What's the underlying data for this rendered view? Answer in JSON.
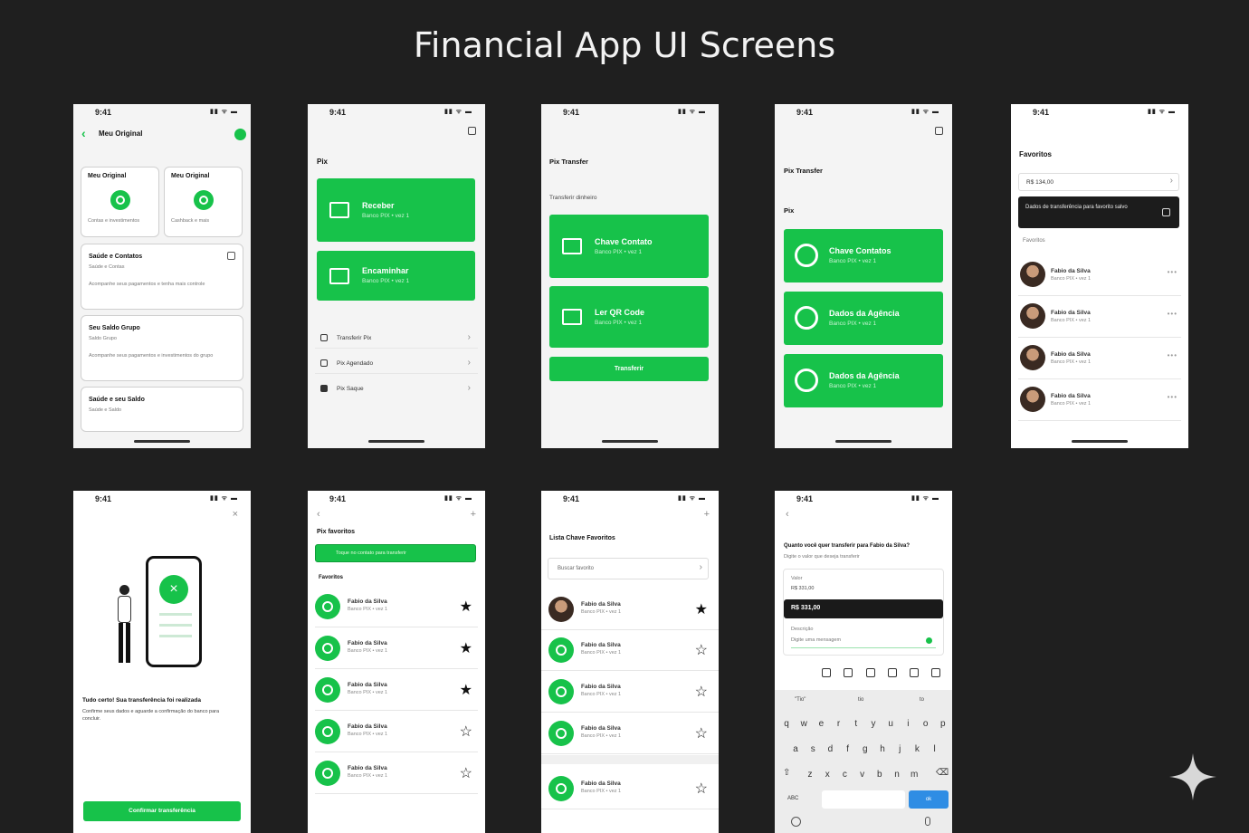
{
  "page_title": "Financial App UI Screens",
  "status_time": "9:41",
  "status_icons": "▮▮ ᯤ ▬",
  "s1": {
    "header": "Meu Original",
    "card_a_title": "Meu Original",
    "card_a_text": "Contas e investimentos",
    "card_b_title": "Meu Original",
    "card_b_text": "Cashback e mais",
    "sec1_title": "Saúde e Contatos",
    "sec1_sub": "Saúde e Contas",
    "sec1_text": "Acompanhe seus pagamentos e tenha mais controle",
    "sec2_title": "Seu Saldo Grupo",
    "sec2_sub": "Saldo Grupo",
    "sec2_text": "Acompanhe seus pagamentos e investimentos do grupo",
    "sec3_title": "Saúde e seu Saldo",
    "sec3_sub": "Saúde e Saldo"
  },
  "s2": {
    "title": "Pix",
    "btn1": "Receber",
    "btn1_sub": "Banco PIX • vez 1",
    "btn2": "Encaminhar",
    "btn2_sub": "Banco PIX • vez 1",
    "list": [
      "Transferir Pix",
      "Pix Agendado",
      "Pix Saque"
    ]
  },
  "s3": {
    "title": "Pix Transfer",
    "sub": "Transferir dinheiro",
    "btn1": "Chave Contato",
    "btn1_sub": "Banco PIX • vez 1",
    "btn2": "Ler QR Code",
    "btn2_sub": "Banco PIX • vez 1",
    "btn3": "Transferir"
  },
  "s4": {
    "title": "Pix Transfer",
    "sub": "Pix",
    "btn1": "Chave Contatos",
    "btn1_sub": "Banco PIX • vez 1",
    "btn2": "Dados da Agência",
    "btn2_sub": "Banco PIX • vez 1",
    "btn3": "Dados da Agência",
    "btn3_sub": "Banco PIX • vez 1"
  },
  "s5": {
    "title": "Favoritos",
    "input": "R$ 134,00",
    "banner": "Dados de transferência para favorito salvo",
    "label": "Favoritos",
    "contacts": [
      {
        "name": "Fabio da Silva",
        "bank": "Banco PIX • vez 1"
      },
      {
        "name": "Fabio da Silva",
        "bank": "Banco PIX • vez 1"
      },
      {
        "name": "Fabio da Silva",
        "bank": "Banco PIX • vez 1"
      },
      {
        "name": "Fabio da Silva",
        "bank": "Banco PIX • vez 1"
      }
    ]
  },
  "s6": {
    "heading": "Tudo certo! Sua transferência foi realizada",
    "text": "Confirme seus dados e aguarde a confirmação do banco para concluir.",
    "button": "Confirmar transferência"
  },
  "s7": {
    "title": "Pix favoritos",
    "banner": "Toque no contato para transferir",
    "label": "Favoritos",
    "contacts": [
      {
        "name": "Fabio da Silva",
        "bank": "Banco PIX • vez 1",
        "star": "★"
      },
      {
        "name": "Fabio da Silva",
        "bank": "Banco PIX • vez 1",
        "star": "★"
      },
      {
        "name": "Fabio da Silva",
        "bank": "Banco PIX • vez 1",
        "star": "★"
      },
      {
        "name": "Fabio da Silva",
        "bank": "Banco PIX • vez 1",
        "star": "☆"
      },
      {
        "name": "Fabio da Silva",
        "bank": "Banco PIX • vez 1",
        "star": "☆"
      }
    ]
  },
  "s8": {
    "title": "Lista Chave Favoritos",
    "search": "Buscar favorito",
    "contacts": [
      {
        "name": "Fabio da Silva",
        "bank": "Banco PIX • vez 1",
        "star": "★"
      },
      {
        "name": "Fabio da Silva",
        "bank": "Banco PIX • vez 1",
        "star": "☆"
      },
      {
        "name": "Fabio da Silva",
        "bank": "Banco PIX • vez 1",
        "star": "☆"
      },
      {
        "name": "Fabio da Silva",
        "bank": "Banco PIX • vez 1",
        "star": "☆"
      },
      {
        "name": "Fabio da Silva",
        "bank": "Banco PIX • vez 1",
        "star": "☆"
      }
    ]
  },
  "s9": {
    "heading": "Quanto você quer transferir para Fabio da Silva?",
    "sub": "Digite o valor que deseja transferir",
    "field_label": "Valor",
    "field_hint": "R$ 331,00",
    "amount": "R$ 331,00",
    "desc_label": "Descrição",
    "desc_value": "Digite uma mensagem",
    "suggestions": [
      "\"Tio\"",
      "tio",
      "to"
    ],
    "row1": [
      "q",
      "w",
      "e",
      "r",
      "t",
      "y",
      "u",
      "i",
      "o",
      "p"
    ],
    "row2": [
      "a",
      "s",
      "d",
      "f",
      "g",
      "h",
      "j",
      "k",
      "l"
    ],
    "row3": [
      "z",
      "x",
      "c",
      "v",
      "b",
      "n",
      "m"
    ],
    "abc": "ABC",
    "go": "ok"
  }
}
